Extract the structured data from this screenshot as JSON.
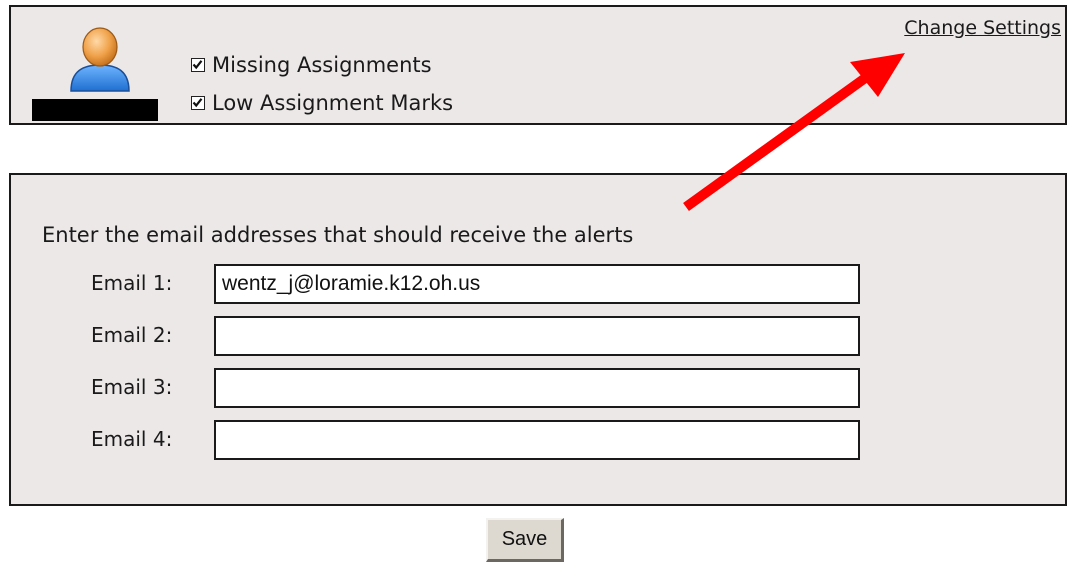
{
  "alerts": {
    "items": [
      {
        "label": "Missing Assignments",
        "checked": true
      },
      {
        "label": "Low Assignment Marks",
        "checked": true
      }
    ],
    "change_settings_label": "Change Settings",
    "avatar_icon": "user-avatar-icon"
  },
  "email_form": {
    "intro": "Enter the email addresses that should receive the alerts",
    "fields": [
      {
        "label": "Email 1:",
        "value": "wentz_j@loramie.k12.oh.us"
      },
      {
        "label": "Email 2:",
        "value": ""
      },
      {
        "label": "Email 3:",
        "value": ""
      },
      {
        "label": "Email 4:",
        "value": ""
      }
    ],
    "save_label": "Save"
  },
  "colors": {
    "panel_bg": "#ece8e8",
    "arrow": "#ff0000",
    "avatar_head": "#f0a24a",
    "avatar_body": "#3a8ee6"
  }
}
